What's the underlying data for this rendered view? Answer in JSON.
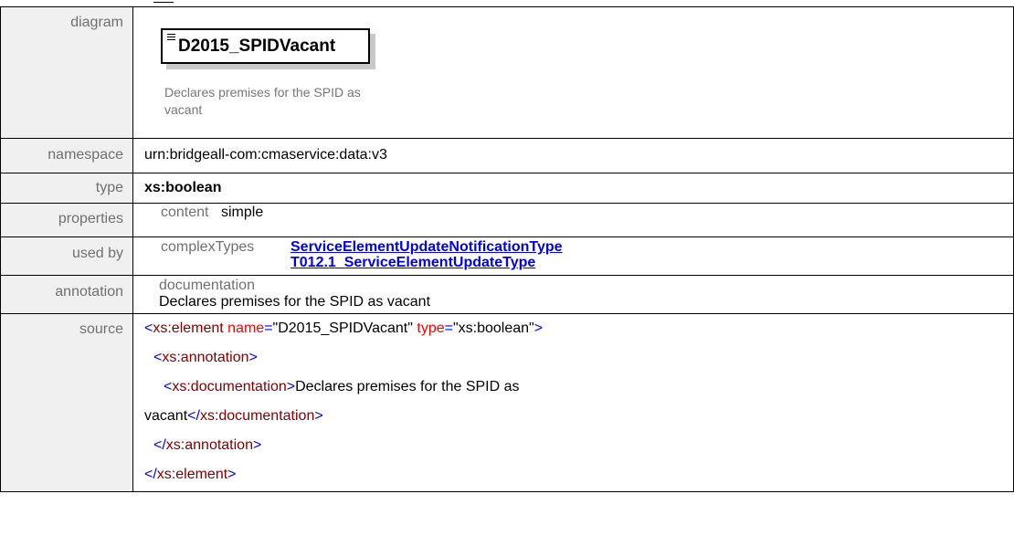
{
  "labels": {
    "diagram": "diagram",
    "namespace": "namespace",
    "type": "type",
    "properties": "properties",
    "used_by": "used by",
    "annotation": "annotation",
    "source": "source"
  },
  "diagram": {
    "element_name": "D2015_SPIDVacant",
    "note": "Declares premises for the SPID as vacant"
  },
  "namespace": "urn:bridgeall-com:cmaservice:data:v3",
  "type": "xs:boolean",
  "properties": {
    "key": "content",
    "value": "simple"
  },
  "used_by": {
    "key": "complexTypes",
    "links": [
      "ServiceElementUpdateNotificationType",
      "T012.1_ServiceElementUpdateType"
    ]
  },
  "annotation": {
    "key": "documentation",
    "text": "Declares premises for the SPID as vacant"
  },
  "source": {
    "lt": "<",
    "gt": ">",
    "close_open": "</",
    "element_tag": "xs:element",
    "name_attr": "name",
    "eq": "=",
    "name_val": "\"D2015_SPIDVacant\"",
    "type_attr": "type",
    "type_val": "\"xs:boolean\"",
    "annotation_tag": "xs:annotation",
    "documentation_tag": "xs:documentation",
    "doc_text_1": "Declares premises for the SPID as",
    "doc_text_2": "vacant"
  },
  "colors": {
    "label_bg": "#f0f0f0",
    "label_text": "#707070",
    "link": "#0000ee",
    "xml_bracket": "#0000ff",
    "xml_attr": "#ff0000",
    "xml_tag": "#800000"
  }
}
